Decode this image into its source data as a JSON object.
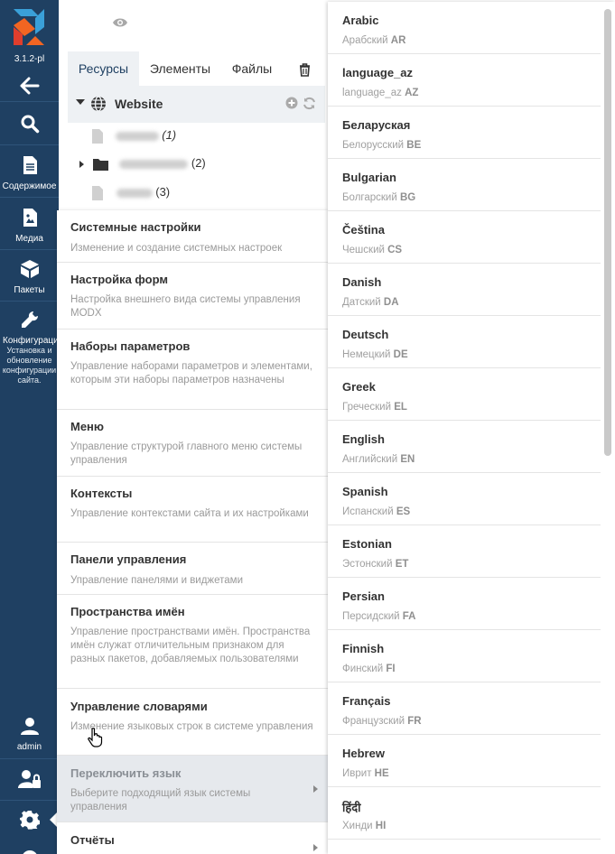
{
  "sidebar": {
    "version": "3.1.2-pl",
    "items": [
      {
        "label": ""
      },
      {
        "label": ""
      },
      {
        "label": "Содержимое"
      },
      {
        "label": "Медиа"
      },
      {
        "label": "Пакеты"
      },
      {
        "label": "Конфигурация",
        "description": "Установка и обновление конфигурации сайта."
      }
    ],
    "user_label": "admin"
  },
  "tree": {
    "tabs": [
      "Ресурсы",
      "Элементы",
      "Файлы"
    ],
    "root_label": "Website",
    "items": [
      {
        "count": "(1)"
      },
      {
        "count": "(2)"
      },
      {
        "count": "(3)"
      }
    ]
  },
  "menu": {
    "items": [
      {
        "title": "Системные настройки",
        "desc": "Изменение и создание системных настроек"
      },
      {
        "title": "Настройка форм",
        "desc": "Настройка внешнего вида системы управления MODX"
      },
      {
        "title": "Наборы параметров",
        "desc": "Управление наборами параметров и элементами, которым эти наборы параметров назначены"
      },
      {
        "title": "Меню",
        "desc": "Управление структурой главного меню системы управления"
      },
      {
        "title": "Контексты",
        "desc": "Управление контекстами сайта и их настройками"
      },
      {
        "title": "Панели управления",
        "desc": "Управление панелями и виджетами"
      },
      {
        "title": "Пространства имён",
        "desc": "Управление пространствами имён. Пространства имён служат отличительным признаком для разных пакетов, добавляемых пользователями"
      },
      {
        "title": "Управление словарями",
        "desc": "Изменение языковых строк в системе управления"
      },
      {
        "title": "Переключить язык",
        "desc": "Выберите подходящий язык системы управления"
      },
      {
        "title": "Отчёты",
        "desc": ""
      }
    ]
  },
  "languages": [
    {
      "name": "Arabic",
      "local": "Арабский",
      "code": "AR"
    },
    {
      "name": "language_az",
      "local": "language_az",
      "code": "AZ"
    },
    {
      "name": "Беларуская",
      "local": "Белорусский",
      "code": "BE"
    },
    {
      "name": "Bulgarian",
      "local": "Болгарский",
      "code": "BG"
    },
    {
      "name": "Čeština",
      "local": "Чешский",
      "code": "CS"
    },
    {
      "name": "Danish",
      "local": "Датский",
      "code": "DA"
    },
    {
      "name": "Deutsch",
      "local": "Немецкий",
      "code": "DE"
    },
    {
      "name": "Greek",
      "local": "Греческий",
      "code": "EL"
    },
    {
      "name": "English",
      "local": "Английский",
      "code": "EN"
    },
    {
      "name": "Spanish",
      "local": "Испанский",
      "code": "ES"
    },
    {
      "name": "Estonian",
      "local": "Эстонский",
      "code": "ET"
    },
    {
      "name": "Persian",
      "local": "Персидский",
      "code": "FA"
    },
    {
      "name": "Finnish",
      "local": "Финский",
      "code": "FI"
    },
    {
      "name": "Français",
      "local": "Французский",
      "code": "FR"
    },
    {
      "name": "Hebrew",
      "local": "Иврит",
      "code": "HE"
    },
    {
      "name": "हिंदी",
      "local": "Хинди",
      "code": "HI"
    }
  ],
  "colors": {
    "sidebar_bg": "#1f4062",
    "logo_blue": "#3aa0d8",
    "logo_orange": "#f26522",
    "logo_red": "#e03e2d",
    "menu_highlight": "#e6e9ed"
  }
}
